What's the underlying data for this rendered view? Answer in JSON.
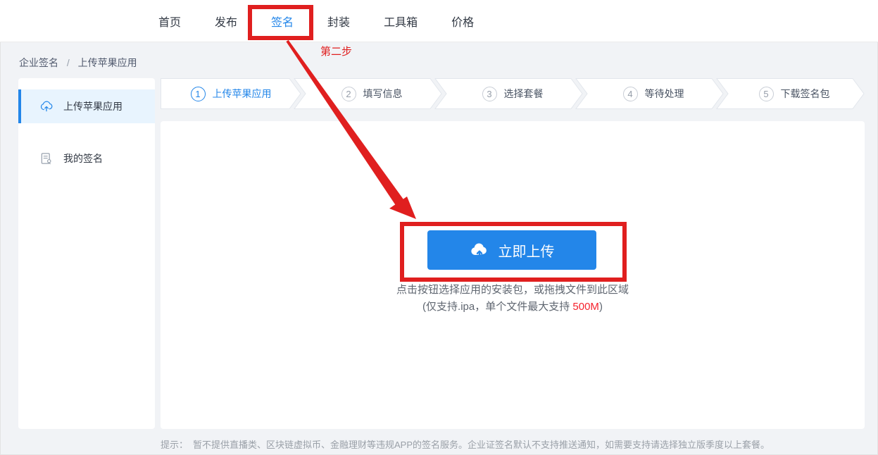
{
  "nav": {
    "items": [
      {
        "label": "首页"
      },
      {
        "label": "发布"
      },
      {
        "label": "签名"
      },
      {
        "label": "封装"
      },
      {
        "label": "工具箱"
      },
      {
        "label": "价格"
      }
    ],
    "active_label": "签名"
  },
  "annotations": {
    "step_note": "第二步"
  },
  "breadcrumb": {
    "parent": "企业签名",
    "separator": "/",
    "current": "上传苹果应用"
  },
  "sidebar": {
    "items": [
      {
        "label": "上传苹果应用",
        "icon": "cloud-upload-icon",
        "active": true
      },
      {
        "label": "我的签名",
        "icon": "signature-doc-icon",
        "active": false
      }
    ]
  },
  "steps": [
    {
      "num": "1",
      "label": "上传苹果应用",
      "active": true
    },
    {
      "num": "2",
      "label": "填写信息",
      "active": false
    },
    {
      "num": "3",
      "label": "选择套餐",
      "active": false
    },
    {
      "num": "4",
      "label": "等待处理",
      "active": false
    },
    {
      "num": "5",
      "label": "下载签名包",
      "active": false
    }
  ],
  "upload": {
    "button_label": "立即上传",
    "hint_line1": "点击按钮选择应用的安装包，或拖拽文件到此区域",
    "hint_line2_prefix": "(仅支持.ipa，单个文件最大支持 ",
    "hint_max_size": "500M",
    "hint_line2_suffix": ")"
  },
  "footer": {
    "tip_label": "提示：",
    "tip_text": "暂不提供直播类、区块链虚拟币、金融理财等违规APP的签名服务。企业证签名默认不支持推送通知，如需要支持请选择独立版季度以上套餐。"
  },
  "colors": {
    "accent_blue": "#2386e9",
    "annotation_red": "#e01f1f",
    "size_red": "#f5222d",
    "page_bg": "#f1f3f6"
  }
}
